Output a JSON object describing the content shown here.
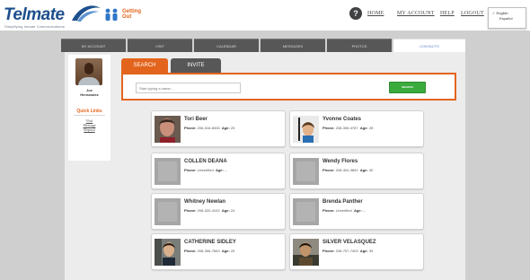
{
  "header": {
    "logo_text": "Telmate",
    "logo_tagline": "Simplifying Inmate Communications",
    "promo_line1": "Getting",
    "promo_line2": "Out",
    "nav": {
      "home": "HOME",
      "my_account": "MY ACCOUNT",
      "help": "HELP",
      "logout": "LOGOUT"
    },
    "language": {
      "selected": "English",
      "other": "Español",
      "check": "✓"
    }
  },
  "tabs": [
    "MY ACCOUNT",
    "VISIT",
    "CALENDAR",
    "MESSAGES",
    "PHOTOS",
    "CONTACTS"
  ],
  "active_tab": "CONTACTS",
  "sidebar": {
    "user_name_line1": "Joe",
    "user_name_line2": "Hernandez",
    "quick_links_title": "Quick Links",
    "quick_links": [
      "Visit",
      "Message",
      "Deposit"
    ]
  },
  "subtabs": {
    "search": "SEARCH",
    "invite": "INVITE"
  },
  "search": {
    "placeholder": "Start typing a name...",
    "button": "SEARCH"
  },
  "labels": {
    "phone": "Phone:",
    "age": "Age:"
  },
  "contacts": [
    {
      "name": "Tori Beer",
      "phone": "206-316-6928",
      "age": "25"
    },
    {
      "name": "Yvonne Coates",
      "phone": "208-306-4787",
      "age": "28"
    },
    {
      "name": "COLLEN DEANA",
      "phone": "Unverified",
      "age": "--"
    },
    {
      "name": "Wendy Flores",
      "phone": "208-404-3892",
      "age": "30"
    },
    {
      "name": "Whitney Newlan",
      "phone": "208-320-4102",
      "age": "24"
    },
    {
      "name": "Brenda Panther",
      "phone": "Unverified",
      "age": "--"
    },
    {
      "name": "CATHERINE SIDLEY",
      "phone": "208-306-7663",
      "age": "25"
    },
    {
      "name": "SILVER VELASQUEZ",
      "phone": "208-757-7403",
      "age": "39"
    }
  ],
  "colors": {
    "brand_blue": "#1d4f8c",
    "accent_orange": "#e3651d",
    "search_green": "#3aaa3d",
    "tab_dark": "#575757"
  }
}
